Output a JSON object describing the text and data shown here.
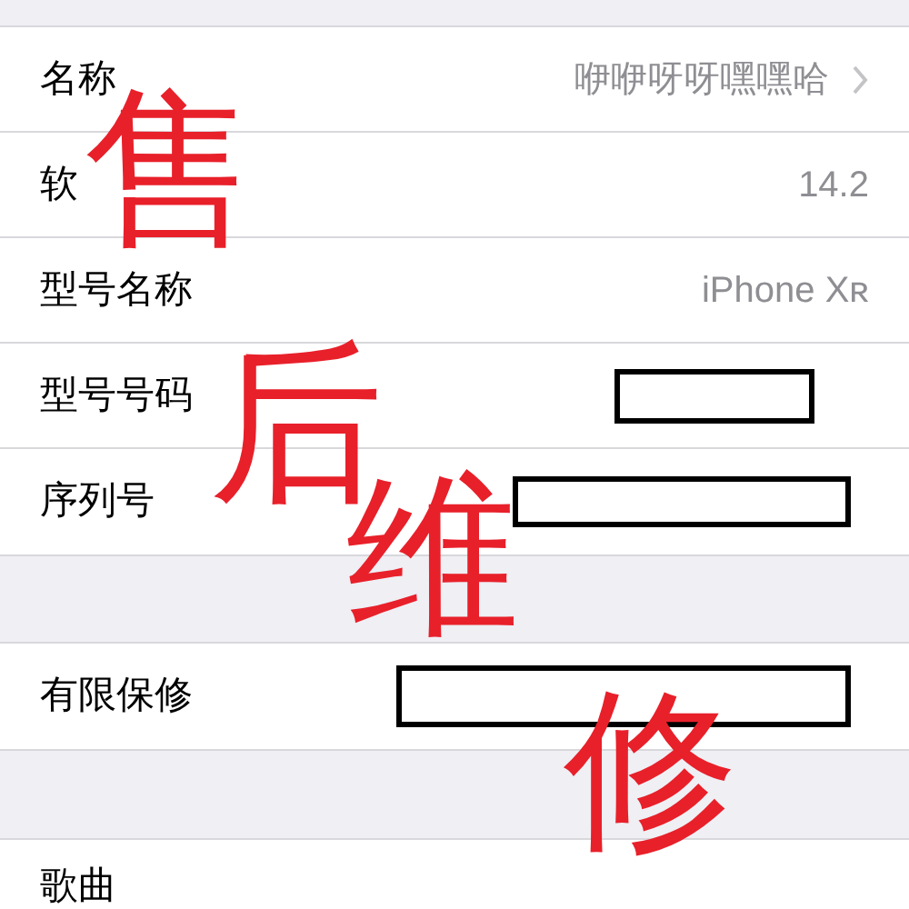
{
  "sections": [
    {
      "rows": [
        {
          "label": "名称",
          "value": "咿咿呀呀嘿嘿哈",
          "chevron": true
        },
        {
          "label": "软",
          "value": "14.2"
        },
        {
          "label": "型号名称",
          "value": "iPhone Xʀ"
        },
        {
          "label": "型号号码",
          "redacted": true
        },
        {
          "label": "序列号",
          "redacted": true
        }
      ]
    },
    {
      "rows": [
        {
          "label": "有限保修",
          "redacted": true
        }
      ]
    },
    {
      "rows": [
        {
          "label": "歌曲"
        }
      ]
    }
  ],
  "annotations": [
    "售",
    "后",
    "维",
    "修"
  ]
}
